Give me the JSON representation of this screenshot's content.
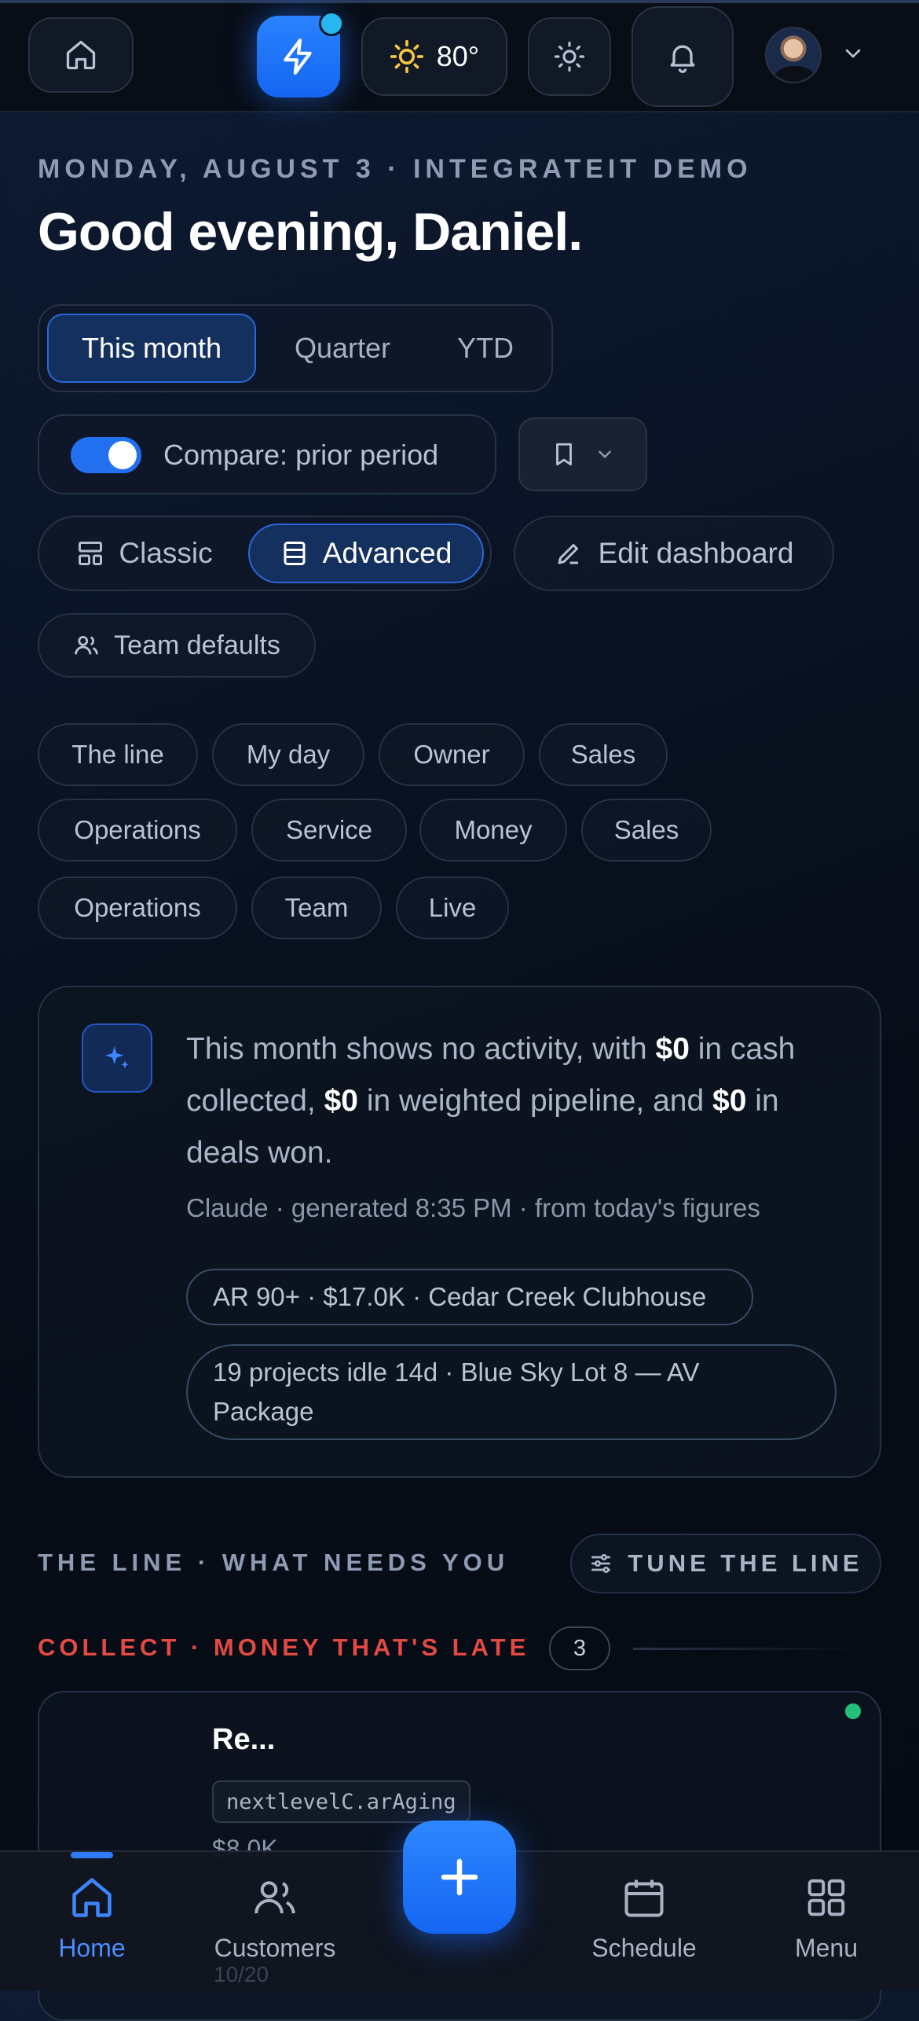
{
  "header": {
    "weather_temp": "80°",
    "accent": "#1f6fff",
    "notification_dot_color": "#26b7f0"
  },
  "greeting": {
    "date_line": "MONDAY, AUGUST 3 · INTEGRATEIT DEMO",
    "title": "Good evening, Daniel."
  },
  "period_tabs": [
    {
      "label": "This month",
      "active": true
    },
    {
      "label": "Quarter",
      "active": false
    },
    {
      "label": "YTD",
      "active": false
    }
  ],
  "compare": {
    "label": "Compare: prior period",
    "enabled": true
  },
  "view_mode": {
    "classic_label": "Classic",
    "advanced_label": "Advanced",
    "active": "Advanced"
  },
  "edit_dashboard_label": "Edit dashboard",
  "team_defaults_label": "Team defaults",
  "chips": {
    "row1": [
      "The line",
      "My day",
      "Owner",
      "Sales"
    ],
    "row2": [
      "Operations",
      "Service",
      "Money",
      "Sales"
    ],
    "row3": [
      "Operations",
      "Team",
      "Live"
    ]
  },
  "summary": {
    "part1": "This month shows no activity, with ",
    "cash": "$0",
    "part2": " in cash collected, ",
    "pipeline": "$0",
    "part3": " in weighted pipeline, and ",
    "won": "$0",
    "part4": " in deals won.",
    "meta": "Claude · generated 8:35 PM · from today's figures",
    "tags": [
      "AR 90+ · $17.0K · Cedar Creek Clubhouse",
      "19 projects idle 14d · Blue Sky Lot 8 — AV Package"
    ]
  },
  "the_line": {
    "heading": "THE LINE · WHAT NEEDS YOU",
    "tune_label": "TUNE THE LINE"
  },
  "collect": {
    "heading": "COLLECT · MONEY THAT'S LATE",
    "count": "3",
    "color": "#e24a43"
  },
  "item": {
    "title": "Re...",
    "code": "nextlevelC.arAging",
    "amount": "$8.0K",
    "status_color": "#22c07a"
  },
  "bottom_nav": [
    {
      "label": "Home",
      "active": true
    },
    {
      "label": "Customers",
      "active": false
    },
    {
      "label": "Schedule",
      "active": false
    },
    {
      "label": "Menu",
      "active": false
    }
  ],
  "bottom_nav_peek": "10/20"
}
